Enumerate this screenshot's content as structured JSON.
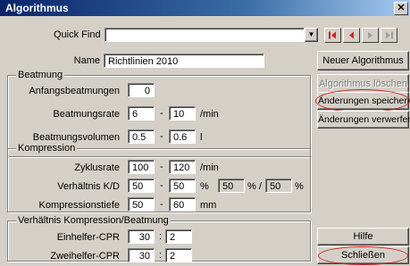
{
  "window": {
    "title": "Algorithmus"
  },
  "quick_find": {
    "label": "Quick Find",
    "value": ""
  },
  "name": {
    "label": "Name",
    "value": "Richtlinien 2010"
  },
  "beatmung": {
    "title": "Beatmung",
    "anfangs": {
      "label": "Anfangsbeatmungen",
      "value": "0"
    },
    "rate": {
      "label": "Beatmungsrate",
      "min": "6",
      "max": "10",
      "unit": "/min"
    },
    "volumen": {
      "label": "Beatmungsvolumen",
      "min": "0.5",
      "max": "0.6",
      "unit": "l"
    }
  },
  "kompression": {
    "title": "Kompression",
    "zyklus": {
      "label": "Zyklusrate",
      "min": "100",
      "max": "120",
      "unit": "/min"
    },
    "verhaeltnis": {
      "label": "Verhältnis K/D",
      "min": "50",
      "max": "50",
      "unit": "%",
      "k": "50",
      "d": "50",
      "unit2": "% /",
      "unit3": "%"
    },
    "tiefe": {
      "label": "Kompressionstiefe",
      "min": "50",
      "max": "60",
      "unit": "mm"
    }
  },
  "ratio": {
    "title": "Verhältnis Kompression/Beatmung",
    "einhelfer": {
      "label": "Einhelfer-CPR",
      "a": "30",
      "b": "2"
    },
    "zweihelfer": {
      "label": "Zweihelfer-CPR",
      "a": "30",
      "b": "2"
    }
  },
  "separators": {
    "dash": "-",
    "colon": ":"
  },
  "buttons": {
    "neuer": "Neuer Algorithmus",
    "loeschen": "Algorithmus löschen",
    "speichern": "Änderungen speichern",
    "verwerfen": "Änderungen verwerfen",
    "hilfe": "Hilfe",
    "schliessen": "Schließen"
  },
  "icons": {
    "close": "✕",
    "dropdown": "▼"
  },
  "colors": {
    "nav_arrow": "#cc2222",
    "annotation_ring": "#cc2222"
  }
}
